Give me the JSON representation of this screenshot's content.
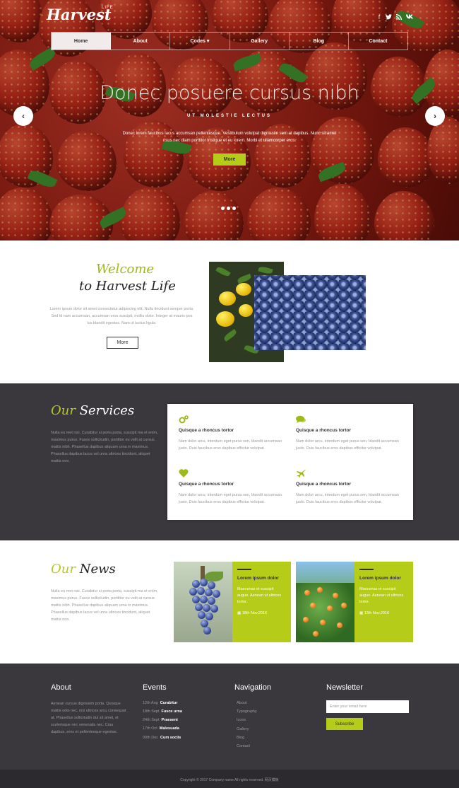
{
  "brand": {
    "logo": "Harvest",
    "tag": "LIFE"
  },
  "social_icons": [
    "facebook-icon",
    "twitter-icon",
    "rss-icon",
    "vk-icon"
  ],
  "nav": [
    {
      "label": "Home",
      "active": true
    },
    {
      "label": "About"
    },
    {
      "label": "Codes ▾"
    },
    {
      "label": "Gallery"
    },
    {
      "label": "Blog"
    },
    {
      "label": "Contact"
    }
  ],
  "hero": {
    "title": "Donec posuere cursus nibh",
    "kicker": "UT MOLESTIE LECTUS",
    "text": "Donec lorem faucibus lacus accumsan pellentesque. Vestibulum volutpat dignissim sem at dapibus. Nunc sit amet risus nec diam porttitor tristique et eu lorem. Morbi et ullamcorper eros.",
    "button": "More",
    "slides": 3
  },
  "welcome": {
    "script": "Welcome",
    "title": "to Harvest Life",
    "text": "Lorem ipsum dolor sit amet consectetur adipiscing elit. Nulla tincidunt semper porta. Sed id nam accumsan, accumsan eros suscipit, mollis dolor. Integer at mauris pos lus blandit egestas. Nam ut luctus ligula.",
    "button": "More"
  },
  "services": {
    "title_accent": "Our",
    "title_rest": "Services",
    "text": "Nulla eu met nisi. Curabitur si porta porta, suscipit ma et enim, maximus purus. Fusce sollicitudin, porttitor eu velit at cursus mattis nibh. Phasellus dapibus aliquam urna in maximus. Phasellus dapibus lacus vel urna ultrices tincidunt, aliquet mattis non.",
    "items": [
      {
        "icon": "gears-icon",
        "title": "Quisque a rhoncus tortor",
        "text": "Nam dolor arcu, interdum eget purus sen, blandit accumsan justo. Duis faucibus eros dapibus efficitur volutpat."
      },
      {
        "icon": "chat-icon",
        "title": "Quisque a rhoncus tortor",
        "text": "Nam dolor arcu, interdum eget purus sen, blandit accumsan justo. Duis faucibus eros dapibus efficitur volutpat."
      },
      {
        "icon": "heart-icon",
        "title": "Quisque a rhoncus tortor",
        "text": "Nam dolor arcu, interdum eget purus sen, blandit accumsan justo. Duis faucibus eros dapibus efficitur volutpat."
      },
      {
        "icon": "plane-icon",
        "title": "Quisque a rhoncus tortor",
        "text": "Nam dolor arcu, interdum eget purus sen, blandit accumsan justo. Duis faucibus eros dapibus efficitur volutpat."
      }
    ]
  },
  "news": {
    "title_accent": "Our",
    "title_rest": "News",
    "text": "Nulla eu met nisi. Curabitur si porta porta, suscipit ma et enim, maximus purus. Fusce sollicitudin, porttitor eu velit at cursus mattis nibh. Phasellus dapibus aliquam urna in maximus. Phasellus dapibus lacus vel urna ultrices tincidunt, aliquet mattis non.",
    "posts": [
      {
        "title": "Lorem ipsum dolor",
        "text": "Maecenas et suscipit augue. Aenean ut ultrices tortor.",
        "date": "18th Nov,2016"
      },
      {
        "title": "Lorem ipsum dolor",
        "text": "Maecenas et suscipit augue. Aenean ut ultrices tortor.",
        "date": "13th Nov,2016"
      }
    ]
  },
  "footer": {
    "about": {
      "heading": "About",
      "text": "Aenean cursus dignissim porta. Quisque mattis odio nec, nisi ultrices arcu consequat at. Phasellus sollicitudin dui sit amet, et scelerisque nec venenatis nec. Cras dapibus, eros et pellentesque egestas."
    },
    "events": {
      "heading": "Events",
      "items": [
        {
          "date": "12th Aug",
          "name": "Curabitur"
        },
        {
          "date": "18th Sept",
          "name": "Fusce urna"
        },
        {
          "date": "24th Sept",
          "name": "Praesent"
        },
        {
          "date": "17th Oct",
          "name": "Malesuada"
        },
        {
          "date": "09th Dec",
          "name": "Cum sociis"
        }
      ]
    },
    "navigation": {
      "heading": "Navigation",
      "links": [
        "About",
        "Typography",
        "Icons",
        "Gallery",
        "Blog",
        "Contact"
      ]
    },
    "newsletter": {
      "heading": "Newsletter",
      "placeholder": "Enter your email here",
      "button": "Subscribe"
    },
    "copyright": "Copyright © 2017 Company name All rights reserved. 网页模板"
  }
}
